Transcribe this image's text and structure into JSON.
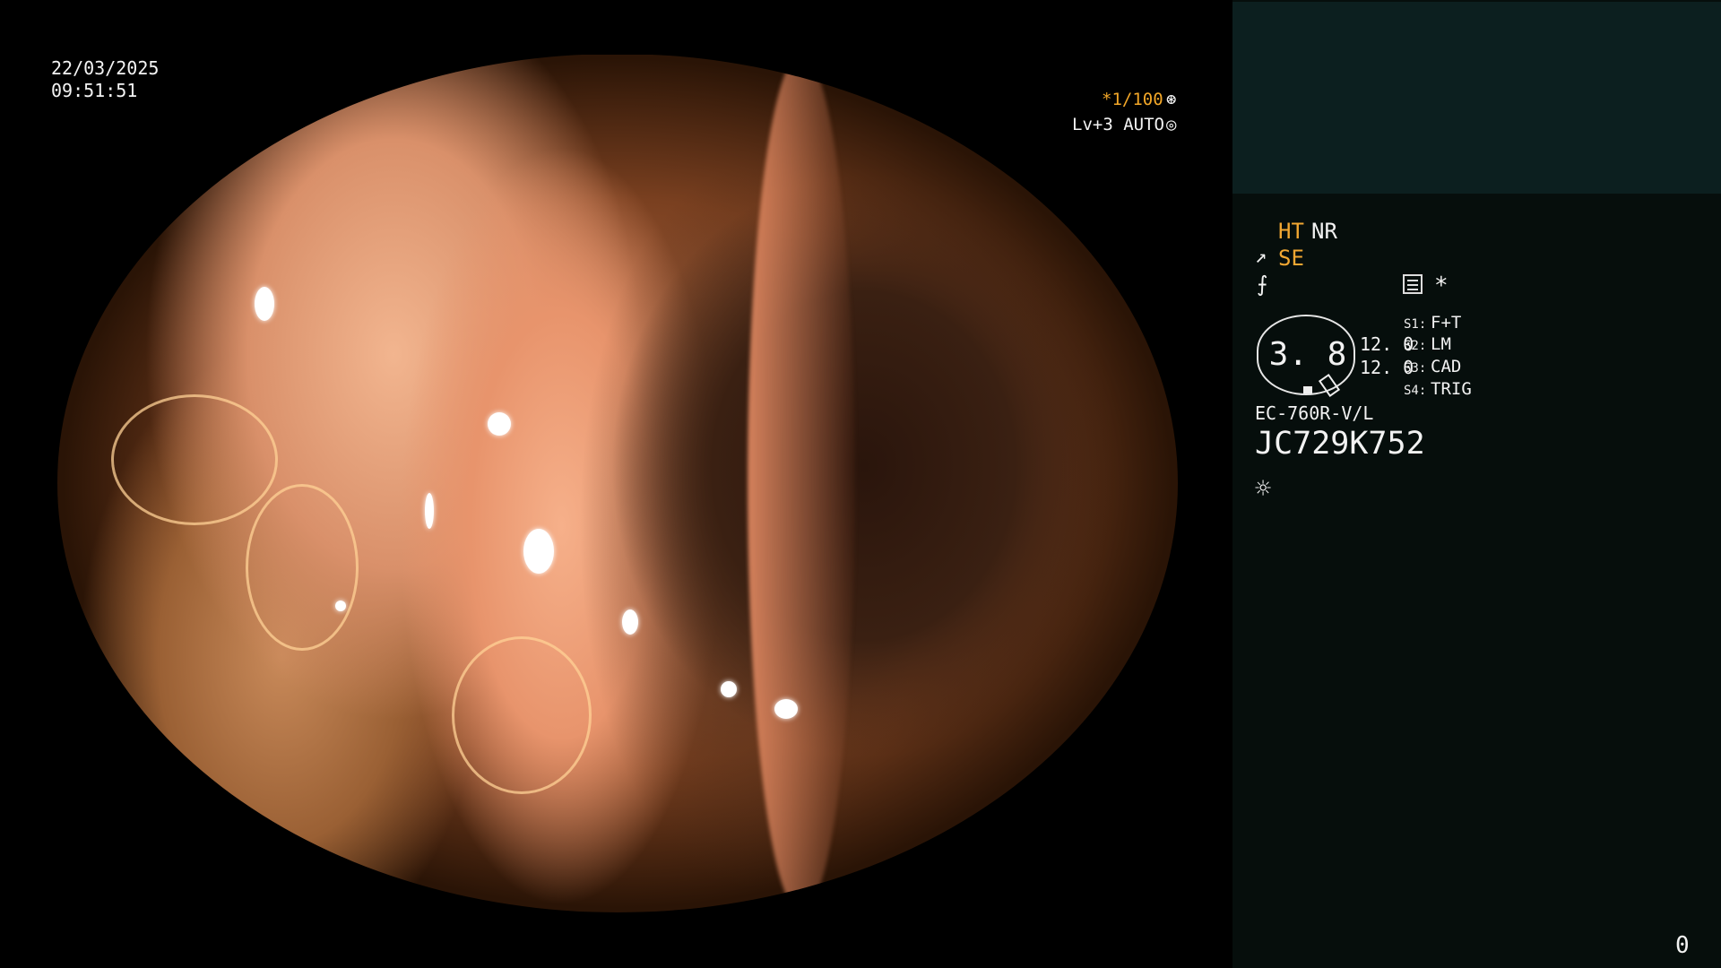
{
  "overlay": {
    "date": "22/03/2025",
    "time": "09:51:51",
    "shutter": "*1/100",
    "shutter_icon": "⊛",
    "level": "Lv+3 AUTO",
    "level_icon": "◎"
  },
  "panel": {
    "ht": "HT",
    "nr": "NR",
    "se_icon": "↗",
    "se": "SE",
    "f_icon": "⨍",
    "asterisk": "*",
    "gauge_value": "3. 8",
    "value1": "12. 0",
    "value2": "12. 0",
    "slots": [
      {
        "key": "S1:",
        "value": "F+T"
      },
      {
        "key": "S2:",
        "value": "LM"
      },
      {
        "key": "S3:",
        "value": "CAD"
      },
      {
        "key": "S4:",
        "value": "TRIG"
      }
    ],
    "model": "EC-760R-V/L",
    "serial": "JC729K752",
    "lamp_icon": "☼",
    "counter": "0"
  },
  "colors": {
    "panel_bg": "#060e0c",
    "panel_top_bg": "#0c1f1f",
    "accent_orange": "#f1a732"
  },
  "icons": [
    "shutter-icon",
    "level-icon",
    "se-icon",
    "f-icon",
    "memo-icon",
    "lamp-icon"
  ]
}
